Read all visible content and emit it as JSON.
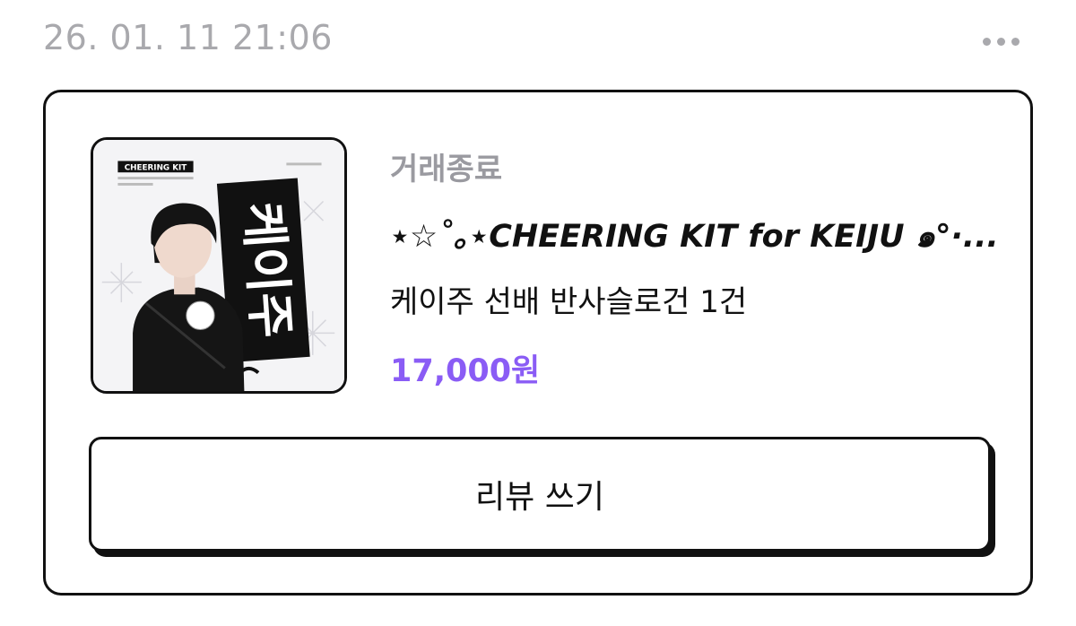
{
  "header": {
    "datetime": "26. 01. 11 21:06",
    "more_icon": "more-horizontal-icon"
  },
  "order": {
    "status": "거래종료",
    "title": "⋆☆˚｡⋆CHEERING KIT for KEIJU ๑°·...",
    "option": "케이주 선배 반사슬로건 1건",
    "price": "17,000원",
    "thumbnail": {
      "badge": "CHEERING KIT",
      "banner_text": "케이주"
    }
  },
  "actions": {
    "review_label": "리뷰 쓰기"
  },
  "colors": {
    "price": "#8a5cf5",
    "muted": "#a9a9ad",
    "border": "#111111"
  }
}
